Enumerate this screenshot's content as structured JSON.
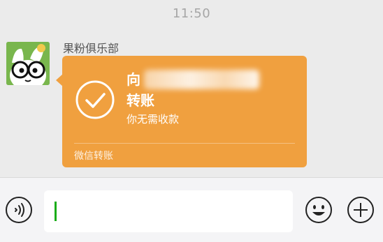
{
  "status": {
    "time": "11:50"
  },
  "chat": {
    "sender_name": "果粉俱乐部",
    "transfer": {
      "title_prefix": "向",
      "title_line2": "转账",
      "note": "你无需收款",
      "footer": "微信转账"
    }
  },
  "input_bar": {
    "text_value": "",
    "icons": [
      "voice-icon",
      "emoji-icon",
      "plus-icon"
    ]
  },
  "colors": {
    "bubble": "#f0a03f",
    "background": "#ebebeb",
    "cursor": "#1aad19",
    "avatar_bg": "#79b64d"
  }
}
